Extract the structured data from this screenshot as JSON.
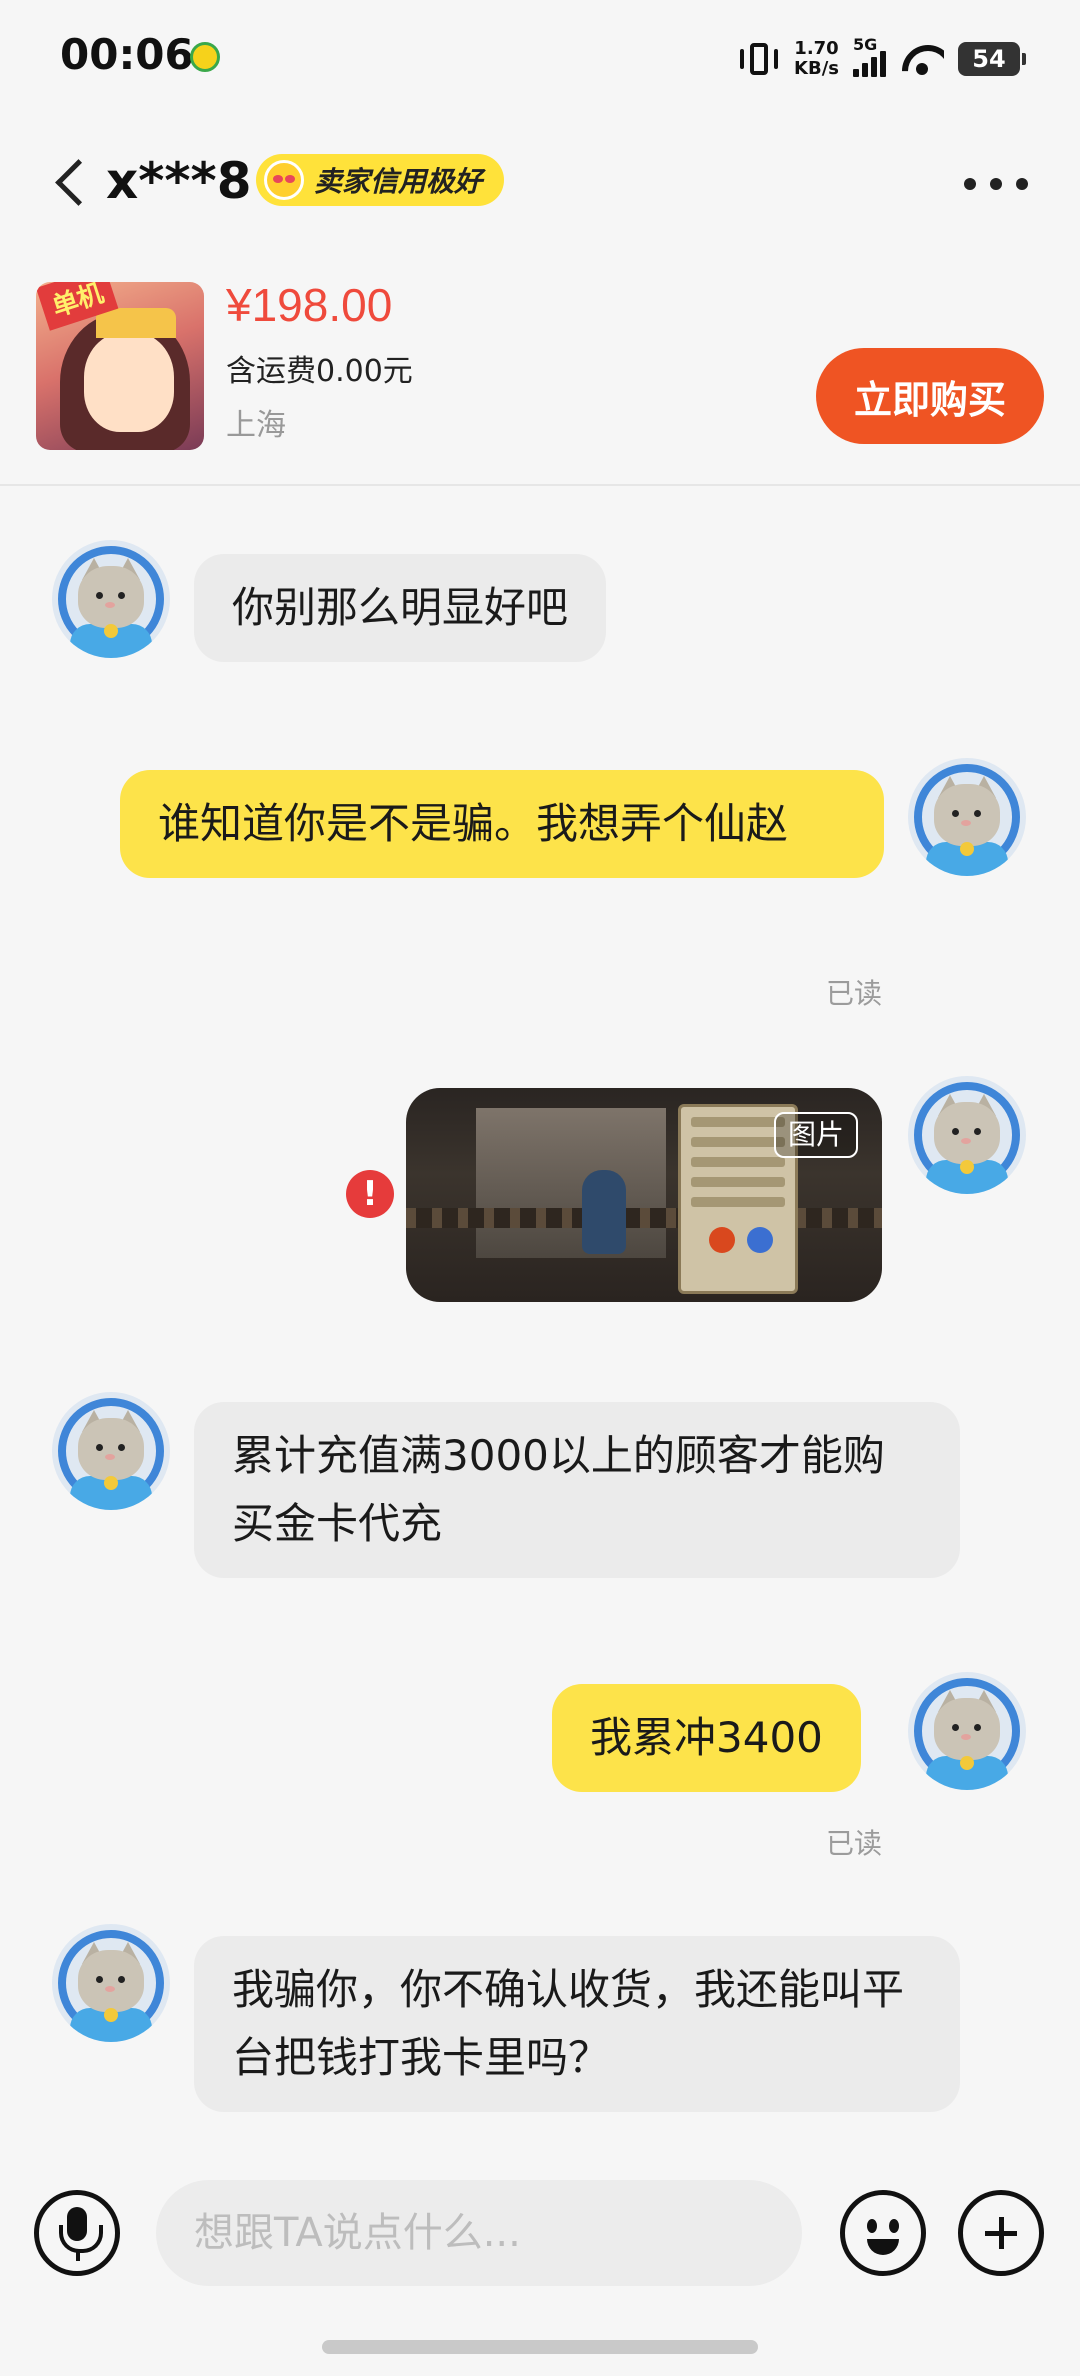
{
  "status_bar": {
    "time": "00:06",
    "speed_value": "1.70",
    "speed_unit": "KB/s",
    "network": "5G",
    "battery": "54"
  },
  "header": {
    "title": "x***8",
    "badge": "卖家信用极好"
  },
  "product": {
    "thumb_tag": "单机",
    "price": "¥198.00",
    "shipping": "含运费0.00元",
    "location": "上海",
    "buy_label": "立即购买"
  },
  "messages": [
    {
      "side": "left",
      "text": "你别那么明显好吧"
    },
    {
      "side": "right",
      "text": "谁知道你是不是骗。我想弄个仙赵",
      "read": "已读"
    },
    {
      "side": "right",
      "type": "image",
      "image_label": "图片",
      "error": "!"
    },
    {
      "side": "left",
      "text": "累计充值满3000以上的顾客才能购买金卡代充"
    },
    {
      "side": "right",
      "text": "我累冲3400",
      "read": "已读"
    },
    {
      "side": "left",
      "text": "我骗你，你不确认收货，我还能叫平台把钱打我卡里吗？"
    }
  ],
  "input": {
    "placeholder": "想跟TA说点什么..."
  },
  "icons": {
    "back": "chevron-left-icon",
    "more": "more-dots-icon",
    "mic": "microphone-icon",
    "emoji": "emoji-icon",
    "plus": "plus-icon"
  },
  "colors": {
    "price": "#ef4a3c",
    "buy_button": "#ef5423",
    "my_bubble": "#fde34a",
    "their_bubble": "#ebebeb",
    "badge": "#ffe23a"
  }
}
